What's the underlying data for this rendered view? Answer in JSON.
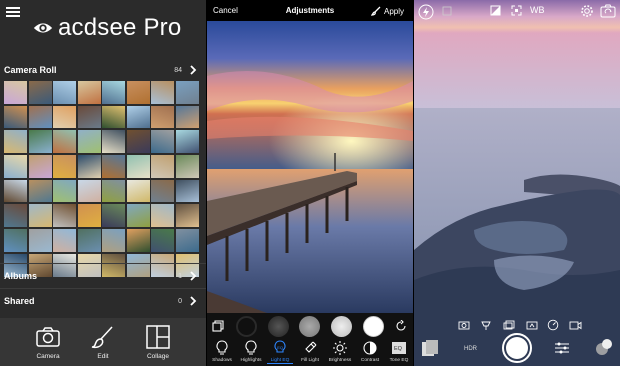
{
  "library": {
    "brand": "acdsee Pro",
    "camera_roll": {
      "label": "Camera Roll",
      "count": "84"
    },
    "albums": {
      "label": "Albums",
      "count": "1"
    },
    "shared": {
      "label": "Shared",
      "count": "0"
    },
    "tabs": [
      {
        "label": "Camera",
        "icon": "camera-icon"
      },
      {
        "label": "Edit",
        "icon": "brush-icon"
      },
      {
        "label": "Collage",
        "icon": "collage-icon"
      }
    ],
    "thumb_colors": [
      "#c9a6d8",
      "#8a6a4a",
      "#6b8fb0",
      "#d8c8a0",
      "#4f6f8f",
      "#c89060",
      "#a8c0d8",
      "#7aa0c0",
      "#3a5a7a",
      "#a07050",
      "#e0d0b0",
      "#6a4a3a",
      "#2f4f2f",
      "#b0d0e8",
      "#d0a070",
      "#557799",
      "#d8b870",
      "#4a7a4a",
      "#c07040",
      "#90b0c8",
      "#e8e0c8",
      "#705030",
      "#3c6a8c",
      "#a8d8e0",
      "#8ab0d0",
      "#c0a070",
      "#e0b040",
      "#2a4a6a",
      "#b07030",
      "#90c0b0",
      "#d0c8b8",
      "#6a8a5a",
      "#604830",
      "#b89060",
      "#a0c070",
      "#c8d8e8",
      "#90a040",
      "#e8e8e0",
      "#708090",
      "#405060",
      "#507890",
      "#a0b8c8",
      "#c0c0c0",
      "#d09050",
      "#3a3a5a",
      "#80a8c0",
      "#e0c090",
      "#605040",
      "#6090c0",
      "#a0a0a0",
      "#d0b0a0",
      "#507060",
      "#b0a080",
      "#e0a060",
      "#405070",
      "#8090a0",
      "#9ab8d0",
      "#c8a878",
      "#6a7a8a",
      "#e8d8a8",
      "#d0b868",
      "#90b8d8",
      "#c0d0e0",
      "#e0c070"
    ]
  },
  "adjust": {
    "cancel": "Cancel",
    "title": "Adjustments",
    "apply": "Apply",
    "tools": [
      {
        "label": "Shadows",
        "icon": "bulb-icon"
      },
      {
        "label": "Highlights",
        "icon": "bulb-icon"
      },
      {
        "label": "Light EQ",
        "icon": "light-eq-icon",
        "active": true
      },
      {
        "label": "Fill Light",
        "icon": "flashlight-icon"
      },
      {
        "label": "Brightness",
        "icon": "sun-icon"
      },
      {
        "label": "Contrast",
        "icon": "contrast-icon"
      },
      {
        "label": "Tone EQ",
        "icon": "tone-eq-icon"
      }
    ],
    "accent": "#2e86ff"
  },
  "camera": {
    "wb": "WB",
    "hdr": "HDR",
    "icons": [
      "flash-icon",
      "aspect-icon",
      "exposure-icon",
      "focus-icon",
      "settings-icon",
      "switch-camera-icon"
    ]
  }
}
